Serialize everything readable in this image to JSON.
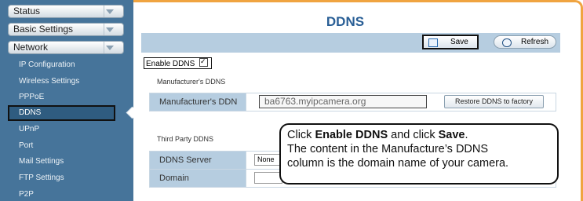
{
  "sidebar": {
    "menus": [
      {
        "label": "Status"
      },
      {
        "label": "Basic Settings"
      },
      {
        "label": "Network"
      }
    ],
    "sub_items": [
      {
        "label": "IP Configuration"
      },
      {
        "label": "Wireless Settings"
      },
      {
        "label": "PPPoE"
      },
      {
        "label": "DDNS"
      },
      {
        "label": "UPnP"
      },
      {
        "label": "Port"
      },
      {
        "label": "Mail Settings"
      },
      {
        "label": "FTP Settings"
      },
      {
        "label": "P2P"
      }
    ]
  },
  "page": {
    "title": "DDNS"
  },
  "toolbar": {
    "save_label": "Save",
    "refresh_label": "Refresh"
  },
  "enable_ddns": {
    "label": "Enable DDNS",
    "checked": true
  },
  "manufacturer": {
    "section_title": "Manufacturer's DDNS",
    "field_label": "Manufacturer's DDN",
    "value": "ba6763.myipcamera.org",
    "restore_label": "Restore DDNS to factory"
  },
  "third_party": {
    "section_title": "Third Party DDNS",
    "server_label": "DDNS Server",
    "server_value": "None",
    "domain_label": "Domain",
    "domain_value": ""
  },
  "callout": {
    "line1_a": "Click ",
    "line1_b": "Enable DDNS",
    "line1_c": " and click ",
    "line1_d": "Save",
    "line1_e": ".",
    "line2": "The content in the Manufacture’s DDNS",
    "line3": "column is the domain name of your camera."
  },
  "colors": {
    "accent": "#2a5f96",
    "sidebar": "#46749a",
    "frame": "#f0a440"
  }
}
